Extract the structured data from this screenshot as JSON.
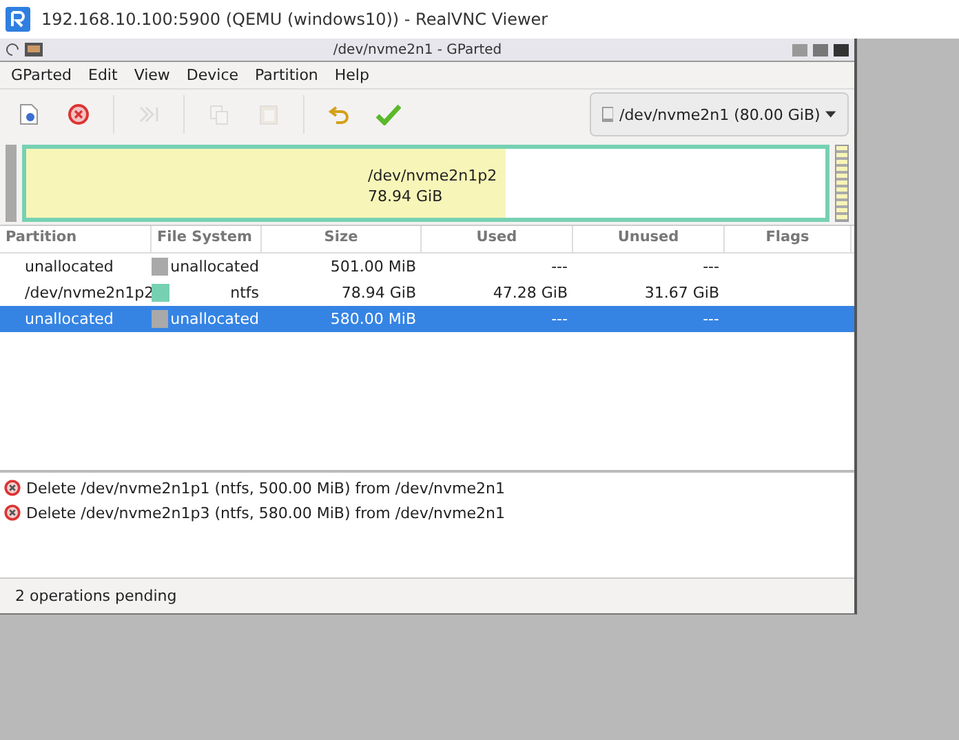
{
  "viewer": {
    "title": "192.168.10.100:5900 (QEMU (windows10)) - RealVNC Viewer"
  },
  "window": {
    "title": "/dev/nvme2n1 - GParted"
  },
  "menu": [
    "GParted",
    "Edit",
    "View",
    "Device",
    "Partition",
    "Help"
  ],
  "toolbar": [
    {
      "kind": "new",
      "disabled": false
    },
    {
      "kind": "delete",
      "disabled": false
    },
    {
      "kind": "sep"
    },
    {
      "kind": "resize",
      "disabled": true
    },
    {
      "kind": "sep"
    },
    {
      "kind": "copy",
      "disabled": true
    },
    {
      "kind": "paste",
      "disabled": true
    },
    {
      "kind": "sep"
    },
    {
      "kind": "undo",
      "disabled": false
    },
    {
      "kind": "apply",
      "disabled": false
    }
  ],
  "device": {
    "label": "/dev/nvme2n1 (80.00 GiB)"
  },
  "graph": {
    "name": "/dev/nvme2n1p2",
    "size": "78.94 GiB",
    "level": 0.6
  },
  "table": {
    "columns": [
      "Partition",
      "File System",
      "Size",
      "Used",
      "Unused",
      "Flags"
    ],
    "rows": [
      {
        "partition": "unallocated",
        "fs": "unallocated",
        "color": "#a9a9a9",
        "size": "501.00 MiB",
        "used": "---",
        "unused": "---",
        "selected": false
      },
      {
        "partition": "/dev/nvme2n1p2",
        "fs": "ntfs",
        "color": "#76d1b3",
        "size": "78.94 GiB",
        "used": "47.28 GiB",
        "unused": "31.67 GiB",
        "selected": false
      },
      {
        "partition": "unallocated",
        "fs": "unallocated",
        "color": "#a9a9a9",
        "size": "580.00 MiB",
        "used": "---",
        "unused": "---",
        "selected": true
      }
    ]
  },
  "operations": [
    "Delete /dev/nvme2n1p1 (ntfs, 500.00 MiB) from /dev/nvme2n1",
    "Delete /dev/nvme2n1p3 (ntfs, 580.00 MiB) from /dev/nvme2n1"
  ],
  "status_bar": "2 operations pending"
}
